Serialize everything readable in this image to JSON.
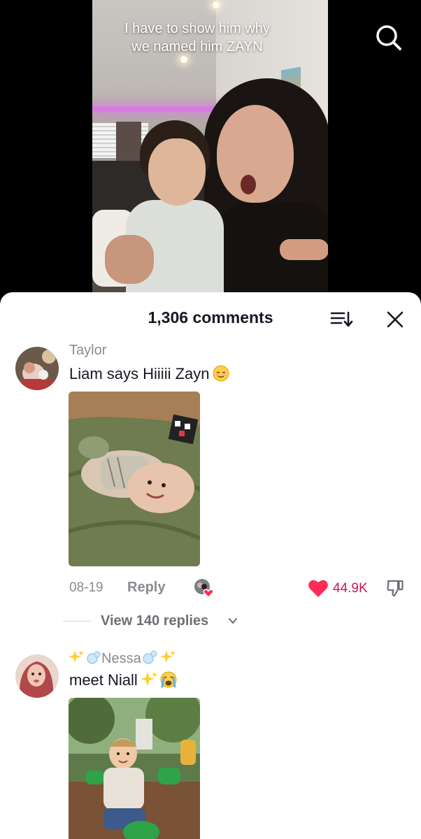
{
  "video": {
    "caption_line1": "I have to show him why",
    "caption_line2": "we named him ZAYN",
    "search_icon": "search-icon"
  },
  "comments_sheet": {
    "count_label": "1,306 comments",
    "sort_icon": "sort-icon",
    "close_icon": "close-icon"
  },
  "comments": [
    {
      "username": "Taylor",
      "text": "Liam says Hiiiii Zayn",
      "emoji": "relieved-face-emoji",
      "date": "08-19",
      "reply_label": "Reply",
      "like_count": "44.9K",
      "view_replies_label": "View 140 replies"
    },
    {
      "username_prefix_emoji": "sparkles-bubbles-emoji",
      "username": "Nessa",
      "username_suffix_emoji": "bubbles-sparkles-emoji",
      "text": "meet Niall",
      "emoji": "sparkles-crying-face-emoji"
    }
  ],
  "colors": {
    "like_red": "#fe2c55",
    "like_count": "#c8174d",
    "muted_text": "#8a8b91",
    "primary_text": "#161823"
  }
}
